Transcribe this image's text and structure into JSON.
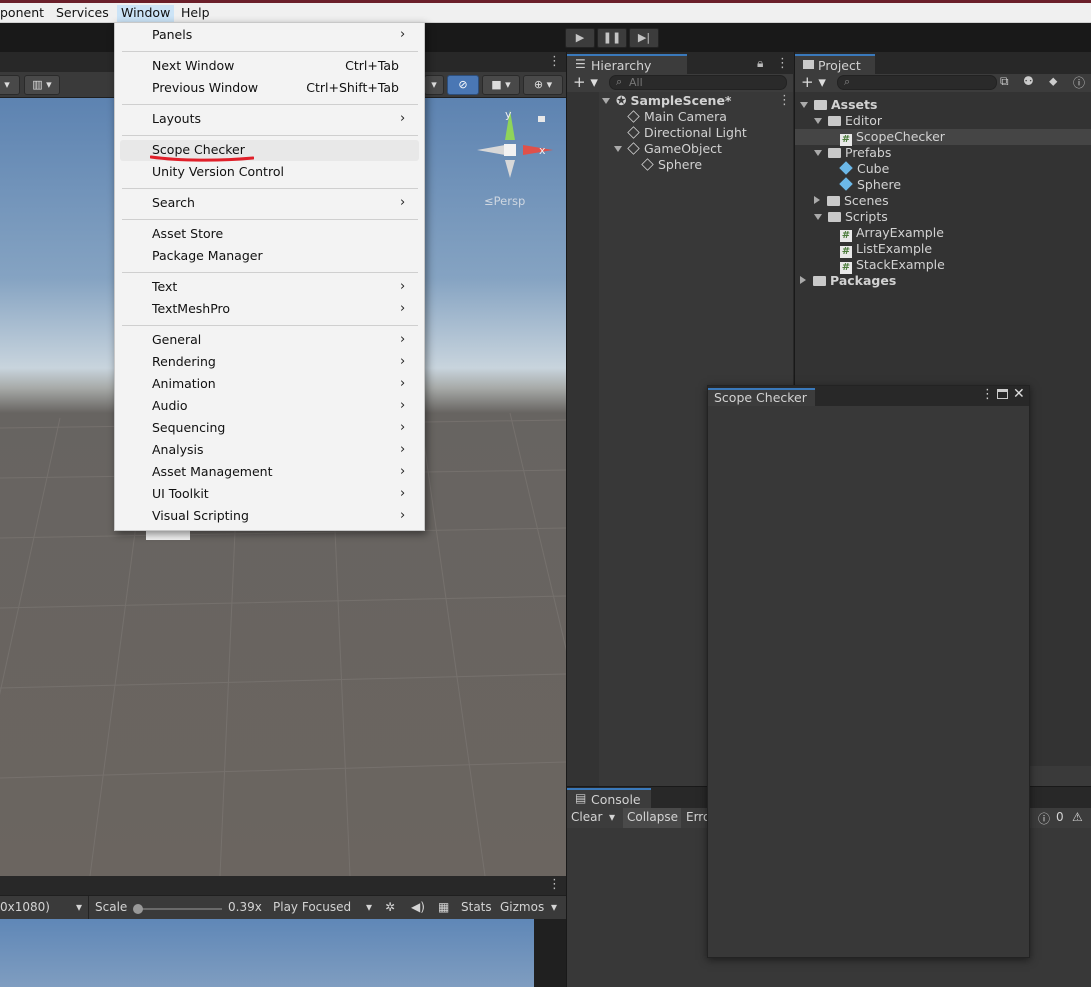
{
  "menubar": {
    "items": [
      "ponent",
      "Services",
      "Window",
      "Help"
    ]
  },
  "toolbar": {
    "play_icon": "play-icon",
    "pause_icon": "pause-icon",
    "step_icon": "step-icon"
  },
  "window_menu": {
    "items": [
      {
        "label": "Panels",
        "submenu": true
      },
      {
        "label": "Next Window",
        "shortcut": "Ctrl+Tab"
      },
      {
        "label": "Previous Window",
        "shortcut": "Ctrl+Shift+Tab"
      },
      {
        "label": "Layouts",
        "submenu": true
      },
      {
        "label": "Scope Checker",
        "highlighted": true
      },
      {
        "label": "Unity Version Control"
      },
      {
        "label": "Search",
        "submenu": true
      },
      {
        "label": "Asset Store"
      },
      {
        "label": "Package Manager"
      },
      {
        "label": "Text",
        "submenu": true
      },
      {
        "label": "TextMeshPro",
        "submenu": true
      },
      {
        "label": "General",
        "submenu": true
      },
      {
        "label": "Rendering",
        "submenu": true
      },
      {
        "label": "Animation",
        "submenu": true
      },
      {
        "label": "Audio",
        "submenu": true
      },
      {
        "label": "Sequencing",
        "submenu": true
      },
      {
        "label": "Analysis",
        "submenu": true
      },
      {
        "label": "Asset Management",
        "submenu": true
      },
      {
        "label": "UI Toolkit",
        "submenu": true
      },
      {
        "label": "Visual Scripting",
        "submenu": true
      }
    ],
    "submenu_glyph": "›",
    "highlight_underline_color": "#e0202a"
  },
  "scene_view": {
    "persp_label": "≤Persp",
    "gizmo_axes": {
      "y": "y",
      "x": "x"
    },
    "axis_colors": {
      "y": "#8fd45a",
      "x": "#e0514a",
      "neutral": "#d8d8d8"
    }
  },
  "game_view": {
    "resolution": "0x1080)",
    "scale_label": "Scale",
    "scale_value": "0.39x",
    "play_mode": "Play Focused",
    "stats": "Stats",
    "gizmos": "Gizmos"
  },
  "hierarchy": {
    "tab": "Hierarchy",
    "search_placeholder": "All",
    "scene": "SampleScene*",
    "items": [
      "Main Camera",
      "Directional Light",
      "GameObject",
      "Sphere"
    ]
  },
  "project": {
    "tab": "Project",
    "tree": {
      "assets": "Assets",
      "editor": "Editor",
      "scope_checker": "ScopeChecker",
      "prefabs": "Prefabs",
      "cube": "Cube",
      "sphere": "Sphere",
      "scenes": "Scenes",
      "scripts": "Scripts",
      "array_example": "ArrayExample",
      "list_example": "ListExample",
      "stack_example": "StackExample",
      "packages": "Packages"
    }
  },
  "console": {
    "tab": "Console",
    "clear": "Clear",
    "collapse": "Collapse",
    "error_pause": "Erro",
    "count": "0"
  },
  "scope_checker_window": {
    "title": "Scope Checker"
  },
  "colors": {
    "accent": "#3a79bb",
    "title_strip": "#6b1f2a"
  }
}
